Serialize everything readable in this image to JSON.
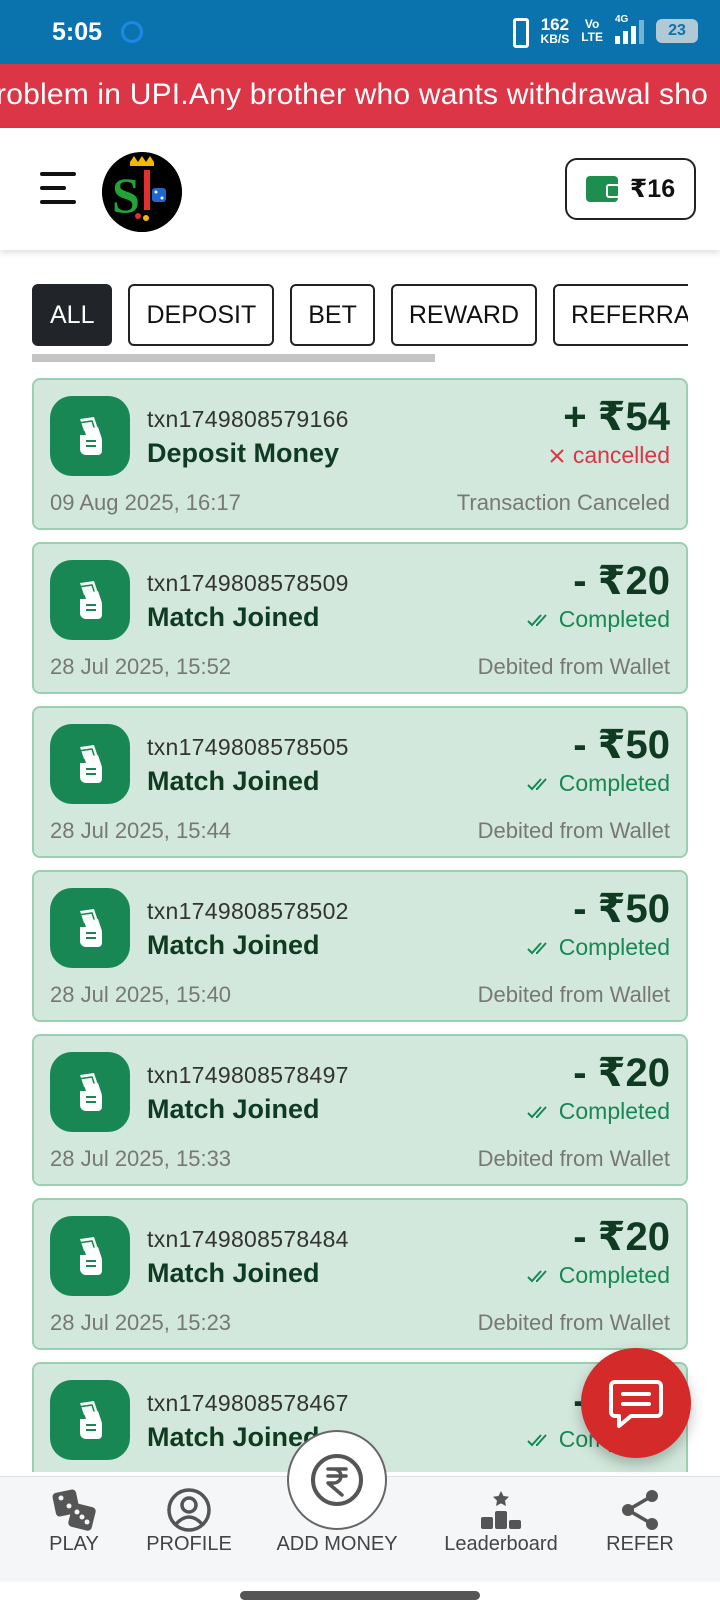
{
  "status_bar": {
    "time": "5:05",
    "speed_value": "162",
    "speed_unit": "KB/S",
    "volte_top": "Vo",
    "volte_bottom": "LTE",
    "network": "4G",
    "battery": "23"
  },
  "announcement": "roblem in UPI.Any brother who wants withdrawal sho",
  "header": {
    "wallet_amount": "₹16",
    "logo_icon": "sl-logo-icon",
    "menu_icon": "hamburger-menu-icon",
    "wallet_icon": "wallet-icon"
  },
  "tabs": [
    {
      "label": "ALL",
      "active": true
    },
    {
      "label": "DEPOSIT",
      "active": false
    },
    {
      "label": "BET",
      "active": false
    },
    {
      "label": "REWARD",
      "active": false
    },
    {
      "label": "REFERRA",
      "active": false
    }
  ],
  "transactions": [
    {
      "txn_id": "txn1749808579166",
      "title": "Deposit Money",
      "amount": "+ ₹54",
      "status": "cancelled",
      "status_type": "cancelled",
      "date": "09 Aug 2025, 16:17",
      "note": "Transaction Canceled"
    },
    {
      "txn_id": "txn1749808578509",
      "title": "Match Joined",
      "amount": "- ₹20",
      "status": "Completed",
      "status_type": "completed",
      "date": "28 Jul 2025, 15:52",
      "note": "Debited from Wallet"
    },
    {
      "txn_id": "txn1749808578505",
      "title": "Match Joined",
      "amount": "- ₹50",
      "status": "Completed",
      "status_type": "completed",
      "date": "28 Jul 2025, 15:44",
      "note": "Debited from Wallet"
    },
    {
      "txn_id": "txn1749808578502",
      "title": "Match Joined",
      "amount": "- ₹50",
      "status": "Completed",
      "status_type": "completed",
      "date": "28 Jul 2025, 15:40",
      "note": "Debited from Wallet"
    },
    {
      "txn_id": "txn1749808578497",
      "title": "Match Joined",
      "amount": "- ₹20",
      "status": "Completed",
      "status_type": "completed",
      "date": "28 Jul 2025, 15:33",
      "note": "Debited from Wallet"
    },
    {
      "txn_id": "txn1749808578484",
      "title": "Match Joined",
      "amount": "- ₹20",
      "status": "Completed",
      "status_type": "completed",
      "date": "28 Jul 2025, 15:23",
      "note": "Debited from Wallet"
    },
    {
      "txn_id": "txn1749808578467",
      "title": "Match Joined",
      "amount": "- ₹20",
      "status": "Completed",
      "status_type": "completed",
      "date": "",
      "note": ""
    }
  ],
  "bottom_nav": [
    {
      "label": "PLAY",
      "icon": "dice-icon"
    },
    {
      "label": "PROFILE",
      "icon": "user-circle-icon"
    },
    {
      "label": "ADD MONEY",
      "icon": "rupee-circle-icon"
    },
    {
      "label": "Leaderboard",
      "icon": "podium-icon"
    },
    {
      "label": "REFER",
      "icon": "share-icon"
    }
  ],
  "chat_fab_icon": "chat-icon",
  "colors": {
    "status_bar": "#0a73ae",
    "announcement_bg": "#dc3545",
    "card_bg": "#d3e8dc",
    "accent_green": "#198754",
    "cancel_red": "#dc3545",
    "fab_red": "#d42a2a"
  }
}
